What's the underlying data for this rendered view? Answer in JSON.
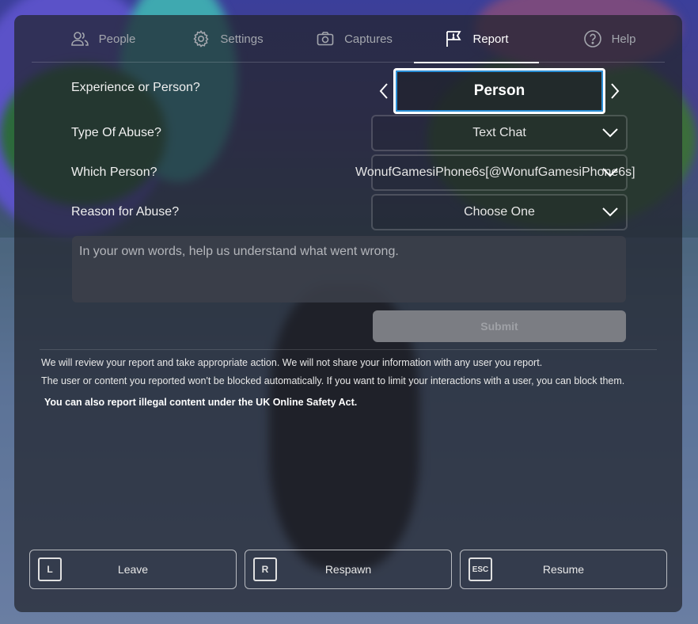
{
  "tabs": [
    {
      "label": "People",
      "icon": "people-icon"
    },
    {
      "label": "Settings",
      "icon": "gear-icon"
    },
    {
      "label": "Captures",
      "icon": "camera-icon"
    },
    {
      "label": "Report",
      "icon": "flag-icon",
      "active": true
    },
    {
      "label": "Help",
      "icon": "help-icon"
    }
  ],
  "form": {
    "experience_label": "Experience or Person?",
    "experience_value": "Person",
    "abuse_type_label": "Type Of Abuse?",
    "abuse_type_value": "Text Chat",
    "which_person_label": "Which Person?",
    "which_person_value": "WonufGamesiPhone6s[@WonufGamesiPhone6s]",
    "reason_label": "Reason for Abuse?",
    "reason_value": "Choose One",
    "description_placeholder": "In your own words, help us understand what went wrong.",
    "submit_label": "Submit"
  },
  "info": {
    "line1": "We will review your report and take appropriate action. We will not share your information with any user you report.",
    "line2": "The user or content you reported won't be blocked automatically. If you want to limit your interactions with a user, you can block them.",
    "line3": "You can also report illegal content under the UK Online Safety Act."
  },
  "bottom_buttons": [
    {
      "key": "L",
      "label": "Leave"
    },
    {
      "key": "R",
      "label": "Respawn"
    },
    {
      "key": "ESC",
      "label": "Resume"
    }
  ],
  "colors": {
    "accent_focus": "#2a8fd6",
    "overlay": "#21242d",
    "submit_disabled": "#7b7d83"
  }
}
